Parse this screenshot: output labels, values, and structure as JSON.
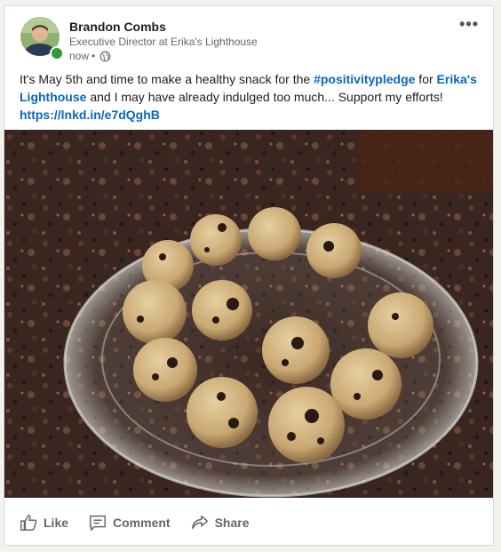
{
  "post": {
    "author_name": "Brandon Combs",
    "author_headline": "Executive Director at Erika's Lighthouse",
    "time": "now",
    "time_separator": "•",
    "more_menu": "•••",
    "text_parts": {
      "intro": "It's May 5th and time to make a healthy snack for the ",
      "hashtag": "#positivitypledge",
      "mid": " for ",
      "mention": "Erika's Lighthouse",
      "outro": " and I may have already indulged too much... Support my efforts! ",
      "link": "https://lnkd.in/e7dQghB"
    }
  },
  "actions": {
    "like": "Like",
    "comment": "Comment",
    "share": "Share"
  },
  "colors": {
    "link": "#0a66c2",
    "presence": "#2e9f33",
    "muted_text": "#666666"
  },
  "icons": [
    "globe-icon",
    "thumbs-up-icon",
    "comment-icon",
    "share-icon",
    "more-icon"
  ]
}
